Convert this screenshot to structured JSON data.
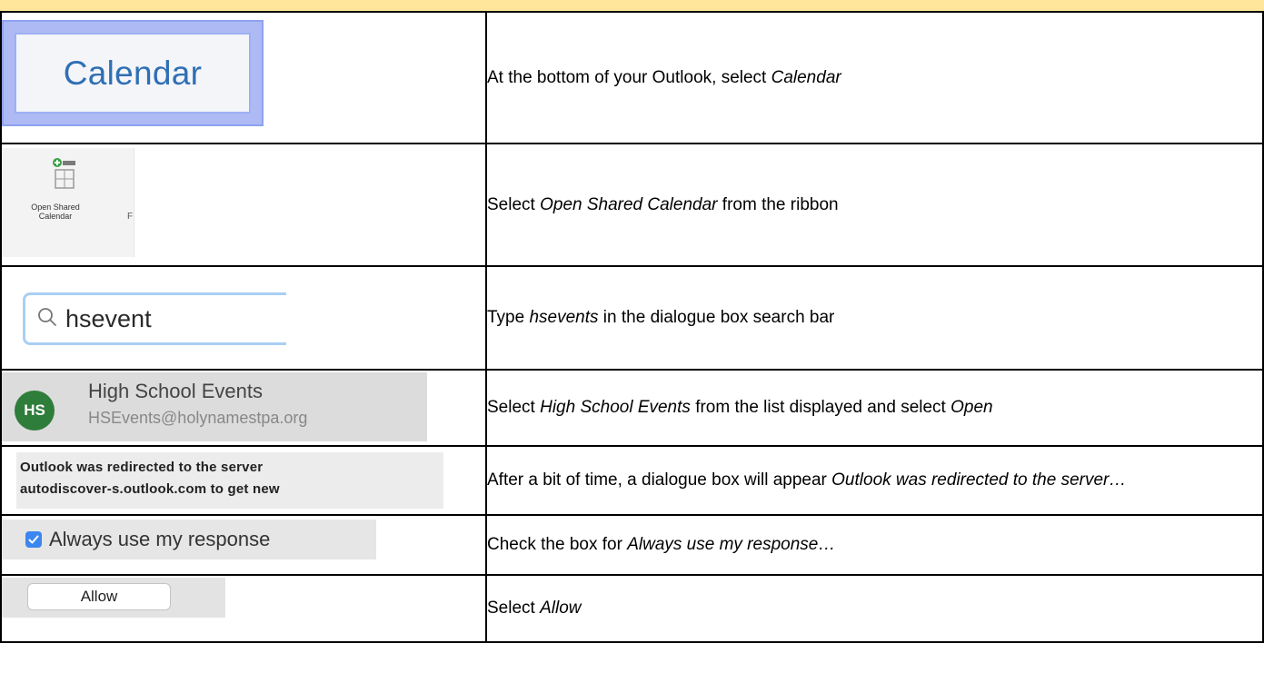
{
  "steps": [
    {
      "shot": {
        "label": "Calendar"
      },
      "desc": {
        "before": "At the bottom of your Outlook, select ",
        "em": "Calendar",
        "after": ""
      }
    },
    {
      "shot": {
        "label_line1": "Open Shared",
        "label_line2": "Calendar",
        "trailing": "F"
      },
      "desc": {
        "before": "Select ",
        "em": "Open Shared Calendar",
        "after": " from the ribbon"
      }
    },
    {
      "shot": {
        "search_value": "hsevent"
      },
      "desc": {
        "before": "Type ",
        "em": "hsevents",
        "after": " in the dialogue box search bar"
      }
    },
    {
      "shot": {
        "avatar_initials": "HS",
        "name": "High School Events",
        "email": "HSEvents@holynamestpa.org"
      },
      "desc": {
        "before": "Select ",
        "em": "High School Events",
        "middle": " from the list displayed and select ",
        "em2": "Open"
      }
    },
    {
      "shot": {
        "line1": "Outlook was redirected to the server",
        "line2": "autodiscover-s.outlook.com to get new"
      },
      "desc": {
        "before": "After a bit of time, a dialogue box will appear ",
        "em": "Outlook was redirected to the server…"
      }
    },
    {
      "shot": {
        "checkbox_label": "Always use my response",
        "checked": true
      },
      "desc": {
        "before": "Check the box for ",
        "em": "Always use my response…"
      }
    },
    {
      "shot": {
        "button_label": "Allow"
      },
      "desc": {
        "before": "Select ",
        "em": "Allow"
      }
    }
  ],
  "colors": {
    "header_band": "#ffe69a",
    "calendar_text": "#2f6fb4",
    "avatar_bg": "#2e7d3a",
    "checkbox_blue": "#3b86f0",
    "search_border": "#a9cff4"
  }
}
